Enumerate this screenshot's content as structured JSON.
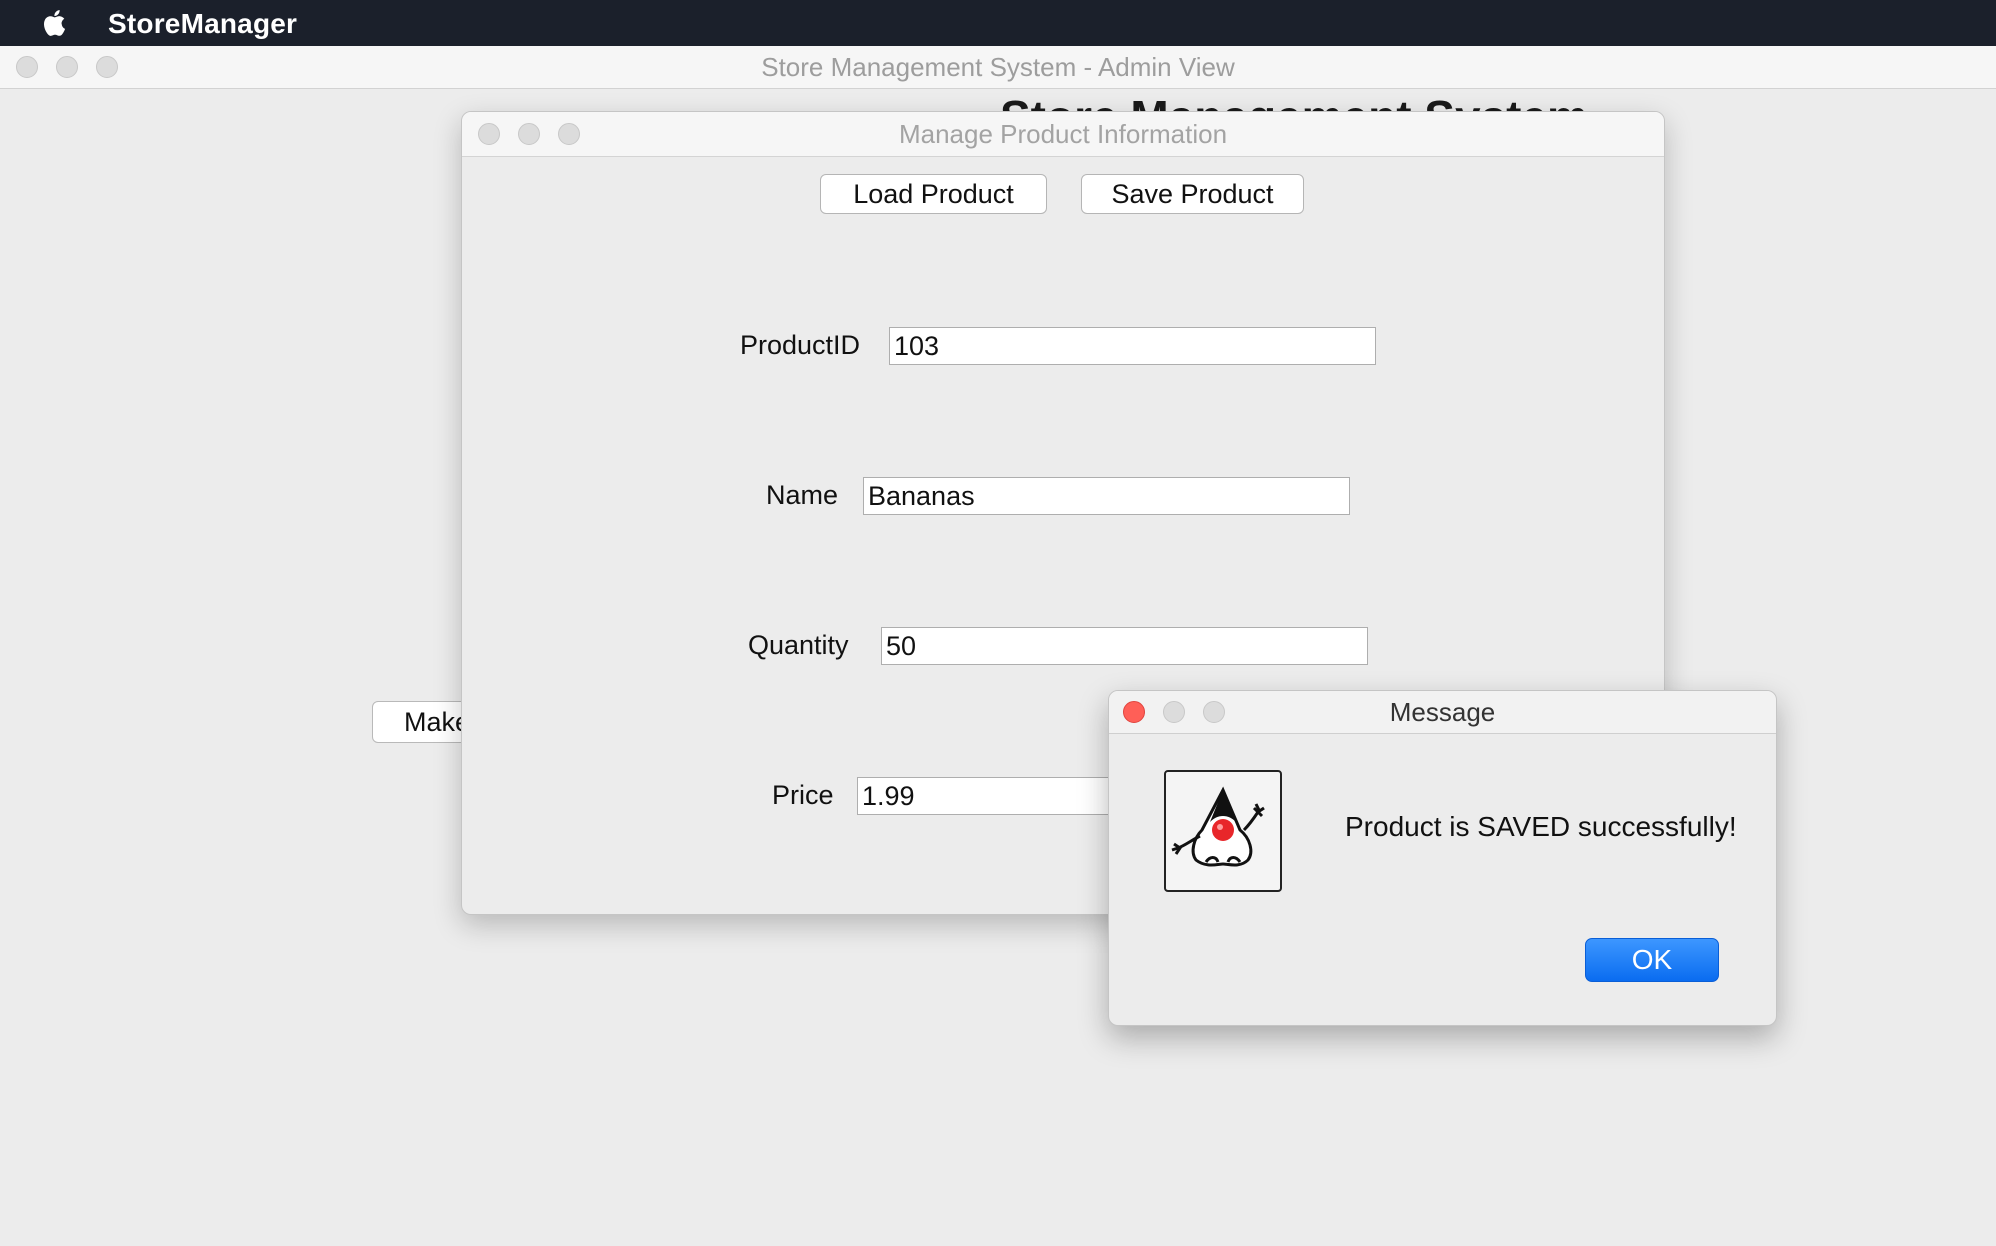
{
  "menubar": {
    "app_name": "StoreManager"
  },
  "main_window": {
    "title": "Store Management System - Admin View",
    "heading": "Store Management System",
    "make_button_label": "Make"
  },
  "product_window": {
    "title": "Manage Product Information",
    "load_button": "Load Product",
    "save_button": "Save Product",
    "fields": {
      "product_id": {
        "label": "ProductID",
        "value": "103"
      },
      "name": {
        "label": "Name",
        "value": "Bananas"
      },
      "quantity": {
        "label": "Quantity",
        "value": "50"
      },
      "price": {
        "label": "Price",
        "value": "1.99"
      }
    }
  },
  "message_dialog": {
    "title": "Message",
    "text": "Product is SAVED successfully!",
    "ok_label": "OK",
    "icon": "duke-mascot-icon",
    "close_color": "#ff5f57"
  }
}
